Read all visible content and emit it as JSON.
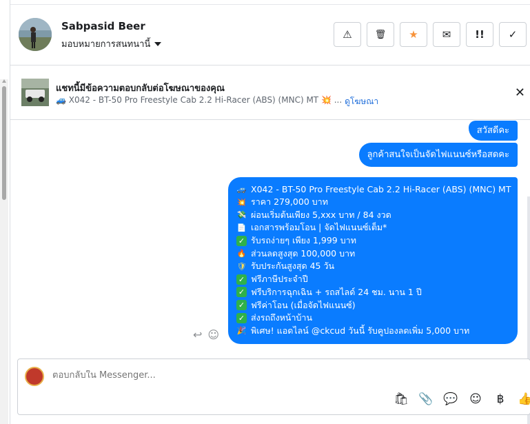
{
  "header": {
    "contact_name": "Sabpasid Beer",
    "assign_label": "มอบหมายการสนทนานี้",
    "actions": [
      {
        "icon": "warning-icon",
        "glyph": "⚠"
      },
      {
        "icon": "trash-icon",
        "glyph": "🗑"
      },
      {
        "icon": "star-icon",
        "glyph": "★"
      },
      {
        "icon": "envelope-open-icon",
        "glyph": "✉"
      },
      {
        "icon": "follow-up-icon",
        "glyph": "!!"
      },
      {
        "icon": "checkmark-icon",
        "glyph": "✓"
      }
    ],
    "star_color": "#f7923a"
  },
  "ad": {
    "title": "แชทนี้มีข้อความตอบกลับต่อโฆษณาของคุณ",
    "subtitle": "🚙 X042 - BT-50 Pro Freestyle Cab 2.2 Hi-Racer (ABS) (MNC) MT 💥 ...",
    "link": "ดูโฆษณา",
    "close_glyph": "✕"
  },
  "messages": {
    "m1": "สวัสดีคะ",
    "m2": "ลูกค้าสนใจเป็นจัดไฟแนนซ์หรือสดคะ",
    "m3_lines": [
      {
        "emoji": "🚙",
        "style": "plain",
        "text": "X042 - BT-50 Pro Freestyle Cab 2.2 Hi-Racer (ABS) (MNC) MT"
      },
      {
        "emoji": "💥",
        "style": "plain",
        "text": "ราคา 279,000 บาท"
      },
      {
        "emoji": "💸",
        "style": "plain",
        "text": "ผ่อนเริ่มต้นเพียง 5,xxx บาท / 84 งวด"
      },
      {
        "emoji": "📄",
        "style": "plain",
        "text": "เอกสารพร้อมโอน | จัดไฟแนนซ์เต็ม*"
      },
      {
        "emoji": "✓",
        "style": "green",
        "text": "รับรถง่ายๆ เพียง 1,999 บาท"
      },
      {
        "emoji": "🔥",
        "style": "plain",
        "text": "ส่วนลดสูงสุด 100,000 บาท"
      },
      {
        "emoji": "🛡",
        "style": "plain",
        "text": "รับประกันสูงสุด 45 วัน"
      },
      {
        "emoji": "✓",
        "style": "green",
        "text": "ฟรีภาษีประจำปี"
      },
      {
        "emoji": "✓",
        "style": "green",
        "text": "ฟรีบริการฉุกเฉิน + รถสไลด์ 24 ชม. นาน 1 ปี"
      },
      {
        "emoji": "✓",
        "style": "green",
        "text": "ฟรีค่าโอน (เมื่อจัดไฟแนนซ์)"
      },
      {
        "emoji": "✓",
        "style": "green",
        "text": "ส่งรถถึงหน้าบ้าน"
      },
      {
        "emoji": "🎉",
        "style": "plain",
        "text": "พิเศษ! แอดไลน์ @ckcud วันนี้ รับคูปองลดเพิ่ม 5,000 บาท"
      }
    ],
    "bubble_color": "#0a7cff"
  },
  "composer": {
    "placeholder": "ตอบกลับใน Messenger...",
    "tools": [
      {
        "icon": "shopping-bag-icon",
        "glyph": "🛍"
      },
      {
        "icon": "paperclip-icon",
        "glyph": "📎"
      },
      {
        "icon": "quick-reply-icon",
        "glyph": "💬"
      },
      {
        "icon": "emoji-icon",
        "glyph": "☺"
      },
      {
        "icon": "baht-icon",
        "glyph": "฿"
      },
      {
        "icon": "thumbs-up-icon",
        "glyph": "👍"
      }
    ]
  }
}
